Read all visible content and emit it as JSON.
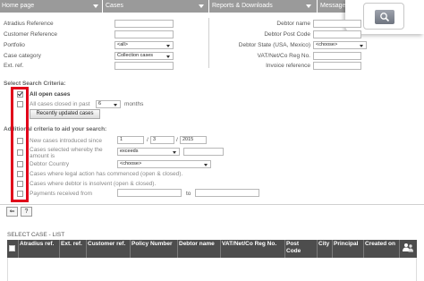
{
  "menu": {
    "home": "Home page",
    "cases": "Cases",
    "reports": "Reports & Downloads",
    "messages": "Messages"
  },
  "search": {
    "atradius_reference": {
      "label": "Atradius Reference",
      "value": ""
    },
    "customer_reference": {
      "label": "Customer Reference",
      "value": ""
    },
    "portfolio": {
      "label": "Portfolio",
      "value": "<all>"
    },
    "case_category": {
      "label": "Case category",
      "value": "Collection cases"
    },
    "ext_ref": {
      "label": "Ext. ref.",
      "value": ""
    },
    "debtor_name": {
      "label": "Debtor name",
      "value": ""
    },
    "debtor_post_code": {
      "label": "Debtor Post Code",
      "value": ""
    },
    "debtor_state": {
      "label": "Debtor State (USA, Mexico)",
      "value": "<choose>"
    },
    "vat_reg_no": {
      "label": "VAT/Net/Co Reg No.",
      "value": ""
    },
    "invoice_reference": {
      "label": "Invoice reference",
      "value": ""
    }
  },
  "criteria": {
    "title": "Select Search Criteria:",
    "all_open_cases": {
      "label": "All open cases",
      "checked": true
    },
    "closed_past": {
      "label": "All cases closed in past",
      "value": "6",
      "unit": "months",
      "checked": false
    },
    "recent_button": "Recently updated cases"
  },
  "additional": {
    "title": "Additional criteria to aid your search:",
    "new_cases": {
      "label": "New cases introduced since",
      "day": "1",
      "month": "3",
      "year": "2015"
    },
    "amount_line1": "Cases selected whereby the",
    "amount_line2": "amount is",
    "amount_op": "exceeds",
    "debtor_country": {
      "label": "Debtor Country",
      "value": "<choose>"
    },
    "legal_action": "Cases where legal action has commenced (open & closed).",
    "insolvent": "Cases where debtor is insolvent (open & closed).",
    "payments": {
      "label": "Payments received from",
      "to": "to"
    },
    "sep": "/"
  },
  "nav": {
    "back": "⇐",
    "help": "?"
  },
  "list": {
    "title": "SELECT CASE - LIST",
    "columns": [
      "Atradius ref.",
      "Ext. ref.",
      "Customer ref.",
      "Policy Number",
      "Debtor name",
      "VAT/Net/Co Reg No.",
      "Post Code",
      "City",
      "Principal",
      "Created on"
    ]
  },
  "colors": {
    "menubar": "#9a9a9a",
    "table_header": "#4d4d4d",
    "highlight": "#e0001a"
  }
}
